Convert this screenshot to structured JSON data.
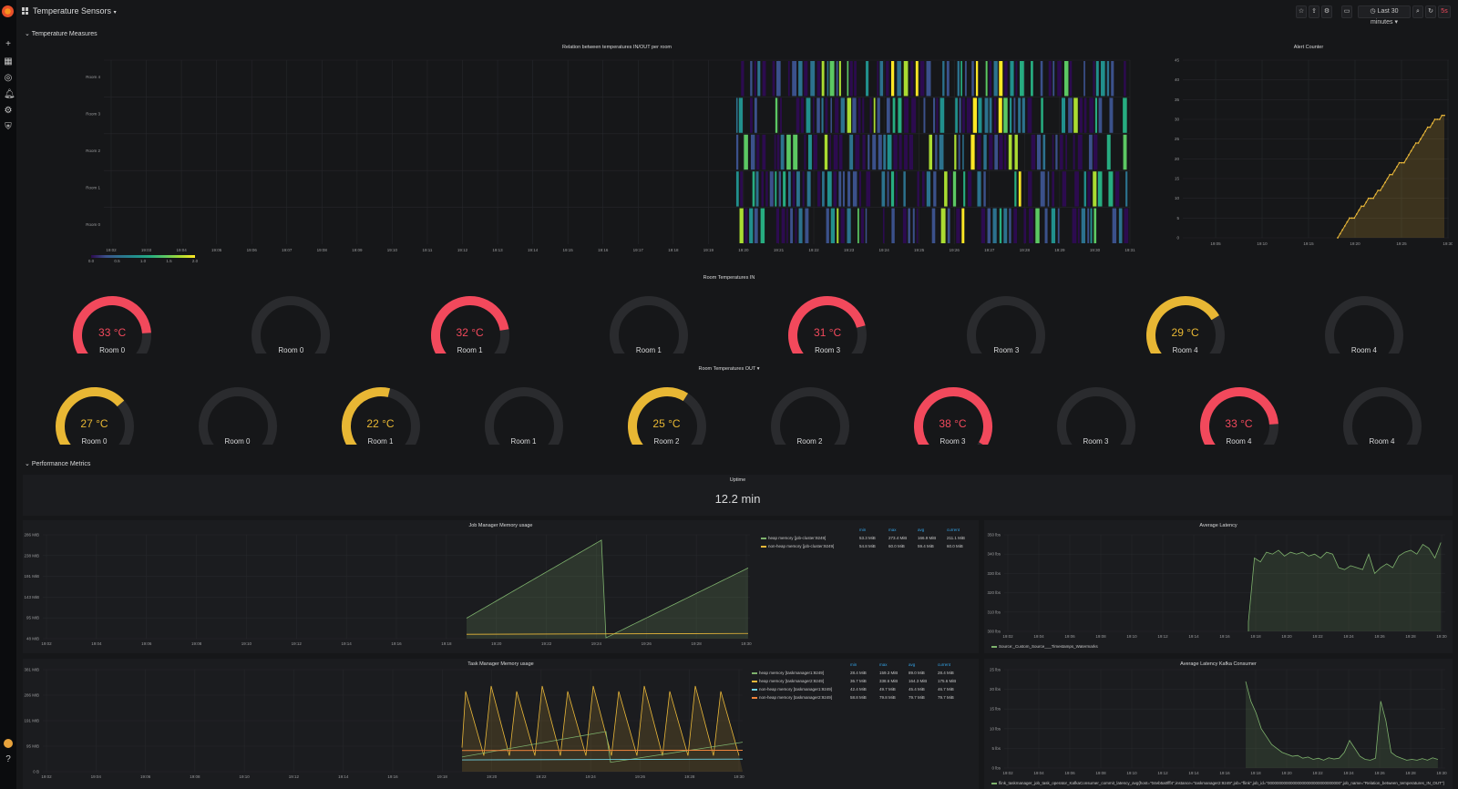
{
  "header": {
    "title": "Temperature Sensors",
    "title_caret": "▾",
    "time_range": "Last 30 minutes",
    "refresh_label": "5s",
    "icons": [
      "star-icon",
      "share-icon",
      "settings-icon",
      "tv-icon",
      "zoom-out-icon",
      "refresh-icon"
    ]
  },
  "sidemenu": {
    "icons": [
      "plus-icon",
      "dashboards-icon",
      "explore-icon",
      "alert-icon",
      "gear-icon",
      "shield-icon",
      "avatar",
      "help-icon"
    ]
  },
  "rows": {
    "temperature": "Temperature Measures",
    "performance": "Performance Metrics"
  },
  "heatmap": {
    "title": "Relation between temperatures IN/OUT per room",
    "y_labels": [
      "Room 4",
      "Room 3",
      "Room 2",
      "Room 1",
      "Room 0"
    ],
    "x_labels": [
      "19:02",
      "19:03",
      "19:04",
      "19:05",
      "19:06",
      "19:07",
      "19:08",
      "19:09",
      "19:10",
      "19:11",
      "19:12",
      "19:13",
      "19:14",
      "19:15",
      "19:16",
      "19:17",
      "19:18",
      "19:19",
      "19:20",
      "19:21",
      "19:22",
      "19:23",
      "19:24",
      "19:25",
      "19:26",
      "19:27",
      "19:28",
      "19:29",
      "19:30",
      "19:31"
    ],
    "scale_labels": [
      "0.0",
      "0.5",
      "1.0",
      "1.5",
      "2.0"
    ]
  },
  "alert": {
    "title": "Alert Counter",
    "y_labels": [
      "45",
      "40",
      "35",
      "30",
      "25",
      "20",
      "15",
      "10",
      "5",
      "0"
    ],
    "x_labels": [
      "19:05",
      "19:10",
      "19:15",
      "19:20",
      "19:25",
      "19:30"
    ]
  },
  "gauges_in": {
    "title": "Room Temperatures IN",
    "items": [
      {
        "value": "33 °C",
        "label": "Room 0",
        "fill": 0.82,
        "color": "#f2495c"
      },
      {
        "value": "",
        "label": "Room 0",
        "fill": 0,
        "color": "#f2495c"
      },
      {
        "value": "32 °C",
        "label": "Room 1",
        "fill": 0.8,
        "color": "#f2495c"
      },
      {
        "value": "",
        "label": "Room 1",
        "fill": 0,
        "color": "#f2495c"
      },
      {
        "value": "31 °C",
        "label": "Room 3",
        "fill": 0.78,
        "color": "#f2495c"
      },
      {
        "value": "",
        "label": "Room 3",
        "fill": 0,
        "color": "#f2495c"
      },
      {
        "value": "29 °C",
        "label": "Room 4",
        "fill": 0.72,
        "color": "#e8b734"
      },
      {
        "value": "",
        "label": "Room 4",
        "fill": 0,
        "color": "#e8b734"
      }
    ]
  },
  "gauges_out": {
    "title": "Room Temperatures OUT",
    "title_caret": "▾",
    "items": [
      {
        "value": "27 °C",
        "label": "Room 0",
        "fill": 0.68,
        "color": "#e8b734"
      },
      {
        "value": "",
        "label": "Room 0",
        "fill": 0,
        "color": "#e8b734"
      },
      {
        "value": "22 °C",
        "label": "Room 1",
        "fill": 0.55,
        "color": "#e8b734"
      },
      {
        "value": "",
        "label": "Room 1",
        "fill": 0,
        "color": "#e8b734"
      },
      {
        "value": "25 °C",
        "label": "Room 2",
        "fill": 0.62,
        "color": "#e8b734"
      },
      {
        "value": "",
        "label": "Room 2",
        "fill": 0,
        "color": "#e8b734"
      },
      {
        "value": "38 °C",
        "label": "Room 3",
        "fill": 0.95,
        "color": "#f2495c"
      },
      {
        "value": "",
        "label": "Room 3",
        "fill": 0,
        "color": "#f2495c"
      },
      {
        "value": "33 °C",
        "label": "Room 4",
        "fill": 0.82,
        "color": "#f2495c"
      },
      {
        "value": "",
        "label": "Room 4",
        "fill": 0,
        "color": "#f2495c"
      }
    ]
  },
  "uptime": {
    "title": "Uptime",
    "value": "12.2 min"
  },
  "jobmem": {
    "title": "Job Manager Memory usage",
    "y_labels": [
      "286 MiB",
      "238 MiB",
      "191 MiB",
      "143 MiB",
      "95 MiB",
      "48 MiB"
    ],
    "x_labels": [
      "19:02",
      "19:04",
      "19:06",
      "19:08",
      "19:10",
      "19:12",
      "19:14",
      "19:16",
      "19:18",
      "19:20",
      "19:22",
      "19:24",
      "19:26",
      "19:28",
      "19:30"
    ],
    "legend_heads": [
      "min",
      "max",
      "avg",
      "current"
    ],
    "legend": [
      {
        "name": "heap memory [job-cluster:9249]",
        "color": "#7eb26d",
        "min": "53.3 MiB",
        "max": "273.4 MiB",
        "avg": "166.9 MiB",
        "current": "211.1 MiB"
      },
      {
        "name": "non-heap memory [job-cluster:9249]",
        "color": "#eab839",
        "min": "54.8 MiB",
        "max": "60.0 MiB",
        "avg": "59.4 MiB",
        "current": "60.0 MiB"
      }
    ]
  },
  "latency": {
    "title": "Average Latency",
    "y_labels": [
      "350 lbs",
      "340 lbs",
      "330 lbs",
      "320 lbs",
      "310 lbs",
      "300 lbs"
    ],
    "x_labels": [
      "19:02",
      "19:04",
      "19:06",
      "19:08",
      "19:10",
      "19:12",
      "19:14",
      "19:16",
      "19:18",
      "19:20",
      "19:22",
      "19:24",
      "19:26",
      "19:28",
      "19:30"
    ],
    "legend": "Source:_Custom_Source___Timestamps_Watermarks"
  },
  "taskmem": {
    "title": "Task Manager Memory usage",
    "y_labels": [
      "381 MiB",
      "286 MiB",
      "191 MiB",
      "95 MiB",
      "0 B"
    ],
    "x_labels": [
      "19:02",
      "19:04",
      "19:06",
      "19:08",
      "19:10",
      "19:12",
      "19:14",
      "19:16",
      "19:18",
      "19:20",
      "19:22",
      "19:24",
      "19:26",
      "19:28",
      "19:30"
    ],
    "legend_heads": [
      "min",
      "max",
      "avg",
      "current"
    ],
    "legend": [
      {
        "name": "heap memory [taskmanager1:9249]",
        "color": "#7eb26d",
        "min": "28.4 MiB",
        "max": "159.3 MiB",
        "avg": "89.0 MiB",
        "current": "28.4 MiB"
      },
      {
        "name": "heap memory [taskmanager2:9249]",
        "color": "#eab839",
        "min": "36.7 MiB",
        "max": "338.6 MiB",
        "avg": "164.3 MiB",
        "current": "175.6 MiB"
      },
      {
        "name": "non-heap memory [taskmanager1:9249]",
        "color": "#6ed0e0",
        "min": "42.4 MiB",
        "max": "49.7 MiB",
        "avg": "45.4 MiB",
        "current": "46.7 MiB"
      },
      {
        "name": "non-heap memory [taskmanager2:9249]",
        "color": "#ef843c",
        "min": "58.8 MiB",
        "max": "79.8 MiB",
        "avg": "79.7 MiB",
        "current": "79.7 MiB"
      }
    ]
  },
  "kafka": {
    "title": "Average Latency Kafka Consumer",
    "y_labels": [
      "25 lbs",
      "20 lbs",
      "15 lbs",
      "10 lbs",
      "5 lbs",
      "0 lbs"
    ],
    "x_labels": [
      "19:02",
      "19:04",
      "19:06",
      "19:08",
      "19:10",
      "19:12",
      "19:14",
      "19:16",
      "19:18",
      "19:20",
      "19:22",
      "19:24",
      "19:26",
      "19:28",
      "19:30"
    ],
    "legend": "flink_taskmanager_job_task_operator_KafkaConsumer_commit_latency_avg{host=\"04eb5a0fff4\",instance=\"taskmanager2:9249\",job=\"flink\",job_id=\"00000000000000000000000000000000\",job_name=\"Relation_between_temperatures_IN_OUT\"}"
  }
}
